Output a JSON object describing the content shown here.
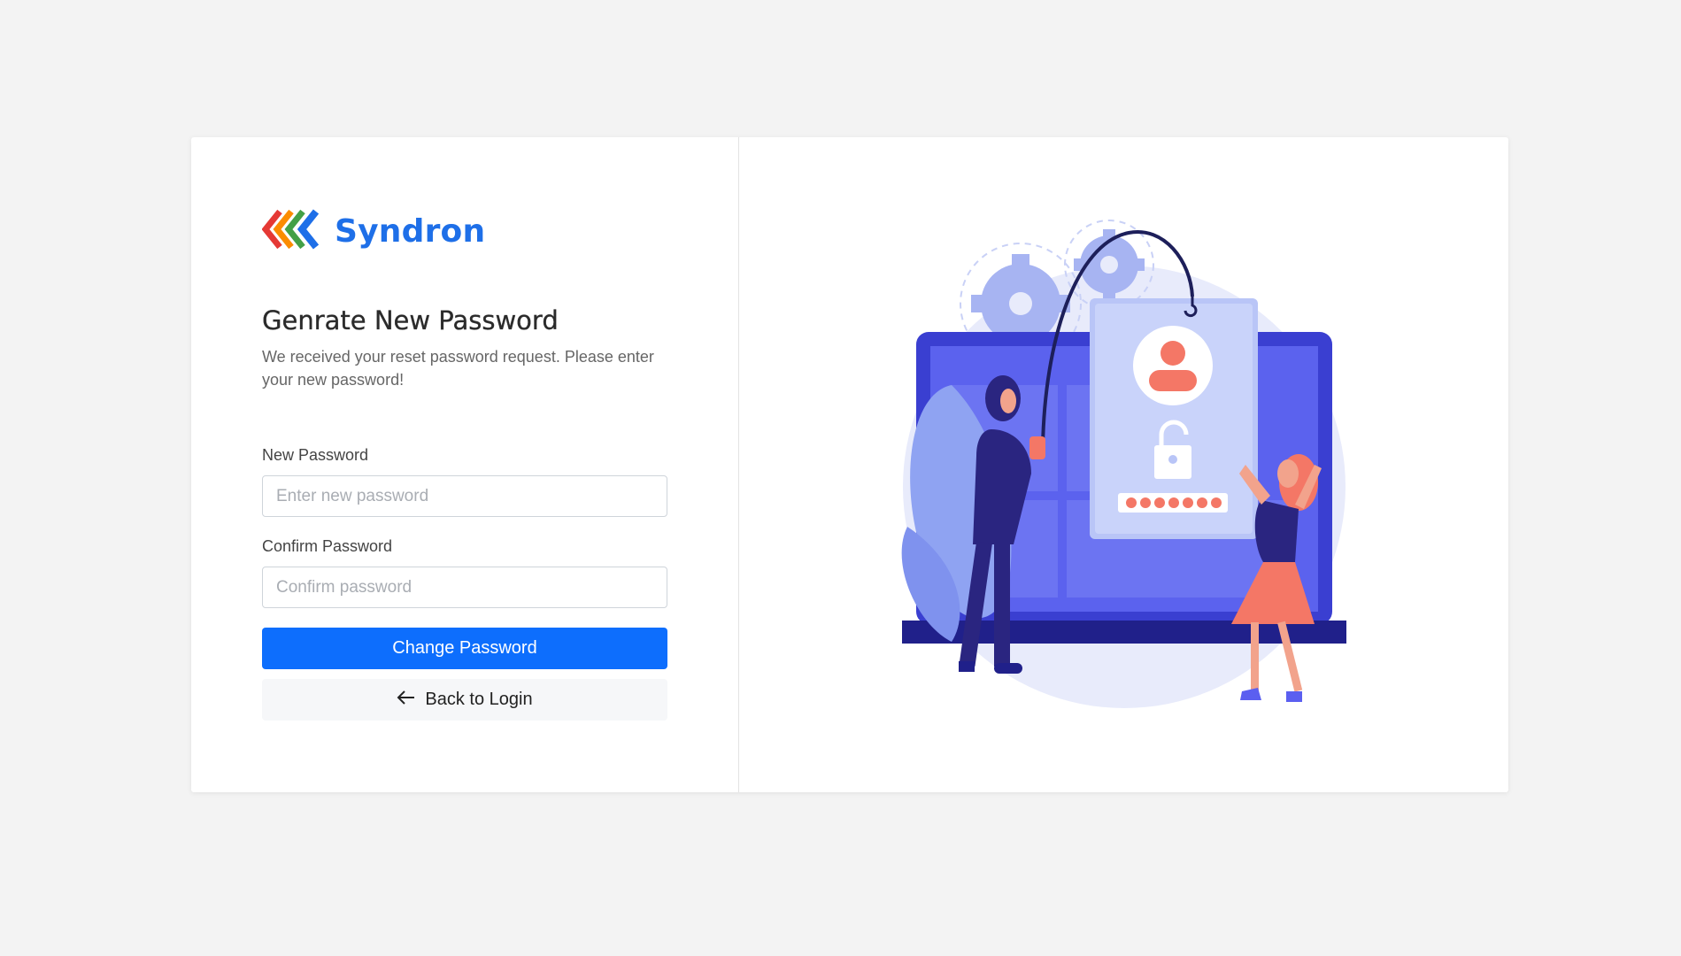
{
  "brand": {
    "name": "Syndron",
    "logo_icon": "chevrons-logo-icon",
    "colors": [
      "#e53935",
      "#fb8c00",
      "#43a047",
      "#1e6fe8"
    ]
  },
  "form": {
    "title": "Genrate New Password",
    "subtitle": "We received your reset password request. Please enter your new password!",
    "new_password": {
      "label": "New Password",
      "placeholder": "Enter new password",
      "value": ""
    },
    "confirm_password": {
      "label": "Confirm Password",
      "placeholder": "Confirm password",
      "value": ""
    },
    "submit_label": "Change Password",
    "back_label": "Back to Login",
    "back_icon": "arrow-left-icon"
  },
  "illustration": {
    "name": "password-phishing-illustration"
  },
  "colors": {
    "primary": "#0d6efd",
    "background": "#f3f3f3",
    "illustration_purple": "#5b5ff0",
    "illustration_coral": "#f47766"
  }
}
